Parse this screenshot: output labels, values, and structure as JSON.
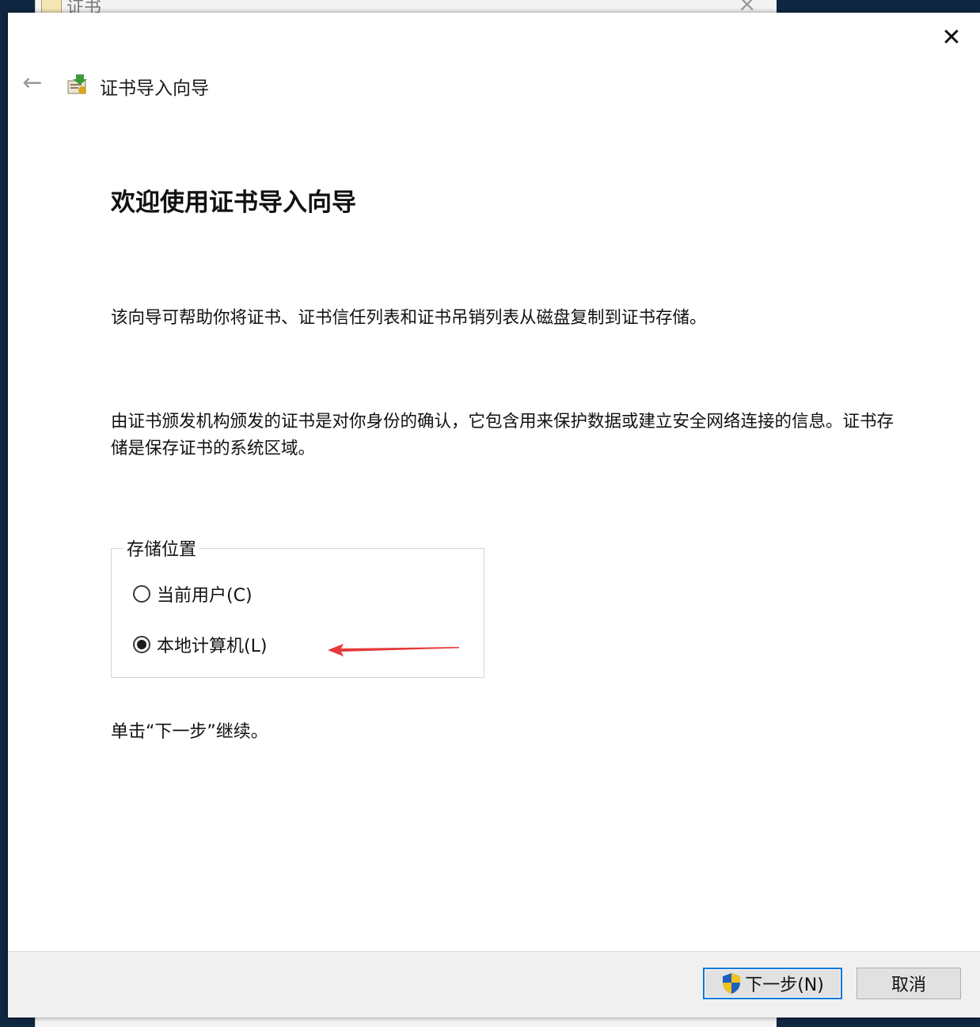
{
  "background_window": {
    "title": "证书"
  },
  "dialog": {
    "title": "证书导入向导",
    "heading": "欢迎使用证书导入向导",
    "description1": "该向导可帮助你将证书、证书信任列表和证书吊销列表从磁盘复制到证书存储。",
    "description2": "由证书颁发机构颁发的证书是对你身份的确认，它包含用来保护数据或建立安全网络连接的信息。证书存储是保存证书的系统区域。",
    "store_location": {
      "label": "存储位置",
      "options": [
        {
          "label": "当前用户(C)",
          "selected": false
        },
        {
          "label": "本地计算机(L)",
          "selected": true
        }
      ]
    },
    "hint": "单击“下一步”继续。",
    "buttons": {
      "next": "下一步(N)",
      "cancel": "取消"
    },
    "icons": {
      "close": "close-icon",
      "back": "back-arrow-icon",
      "wizard": "certificate-wizard-icon",
      "shield": "uac-shield-icon",
      "annotation": "red-arrow-annotation"
    },
    "colors": {
      "accent": "#0078d7",
      "annotation": "#e8393a"
    }
  }
}
